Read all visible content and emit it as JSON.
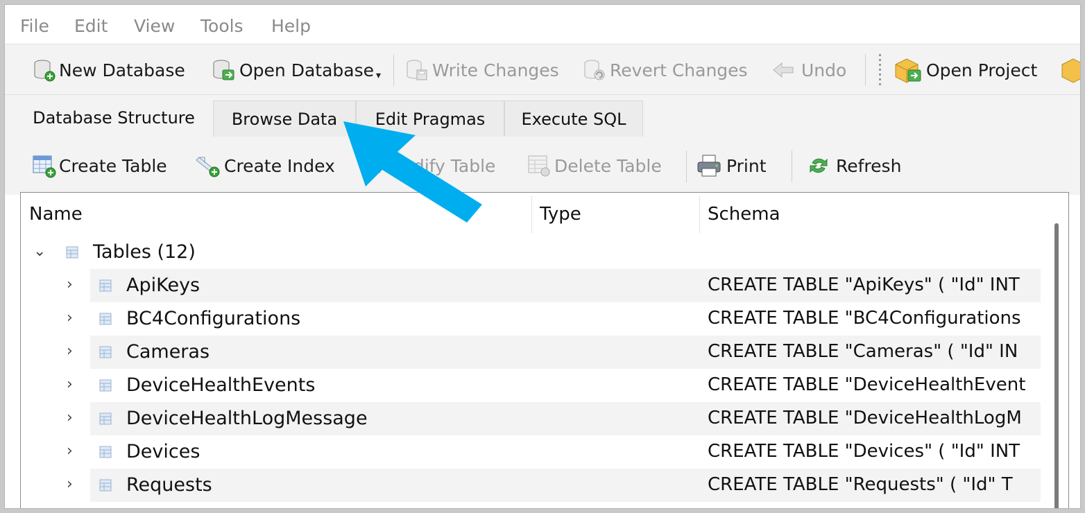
{
  "menu": {
    "file": "File",
    "edit": "Edit",
    "view": "View",
    "tools": "Tools",
    "help": "Help"
  },
  "toolbar": {
    "new_database": "New Database",
    "open_database": "Open Database",
    "write_changes": "Write Changes",
    "revert_changes": "Revert Changes",
    "undo": "Undo",
    "open_project": "Open Project"
  },
  "tabs": {
    "database_structure": "Database Structure",
    "browse_data": "Browse Data",
    "edit_pragmas": "Edit Pragmas",
    "execute_sql": "Execute SQL",
    "active": "Database Structure"
  },
  "structure_toolbar": {
    "create_table": "Create Table",
    "create_index": "Create Index",
    "modify_table": "Modify Table",
    "delete_table": "Delete Table",
    "print": "Print",
    "refresh": "Refresh"
  },
  "tree": {
    "columns": {
      "name": "Name",
      "type": "Type",
      "schema": "Schema"
    },
    "group": {
      "label": "Tables (12)"
    },
    "rows": [
      {
        "name": "ApiKeys",
        "schema": "CREATE TABLE \"ApiKeys\" ( \"Id\" INT"
      },
      {
        "name": "BC4Configurations",
        "schema": "CREATE TABLE \"BC4Configurations"
      },
      {
        "name": "Cameras",
        "schema": "CREATE TABLE \"Cameras\" ( \"Id\" IN"
      },
      {
        "name": "DeviceHealthEvents",
        "schema": "CREATE TABLE \"DeviceHealthEvent"
      },
      {
        "name": "DeviceHealthLogMessage",
        "schema": "CREATE TABLE \"DeviceHealthLogM"
      },
      {
        "name": "Devices",
        "schema": "CREATE TABLE \"Devices\" ( \"Id\" INT"
      },
      {
        "name": "Requests",
        "schema": "CREATE TABLE \"Requests\" ( \"Id\" T"
      }
    ]
  },
  "colors": {
    "annotation_arrow": "#00aeef",
    "window_bg": "#f3f3f3",
    "row_alt": "#f3f3f3",
    "disabled_text": "#9a9a9a"
  }
}
